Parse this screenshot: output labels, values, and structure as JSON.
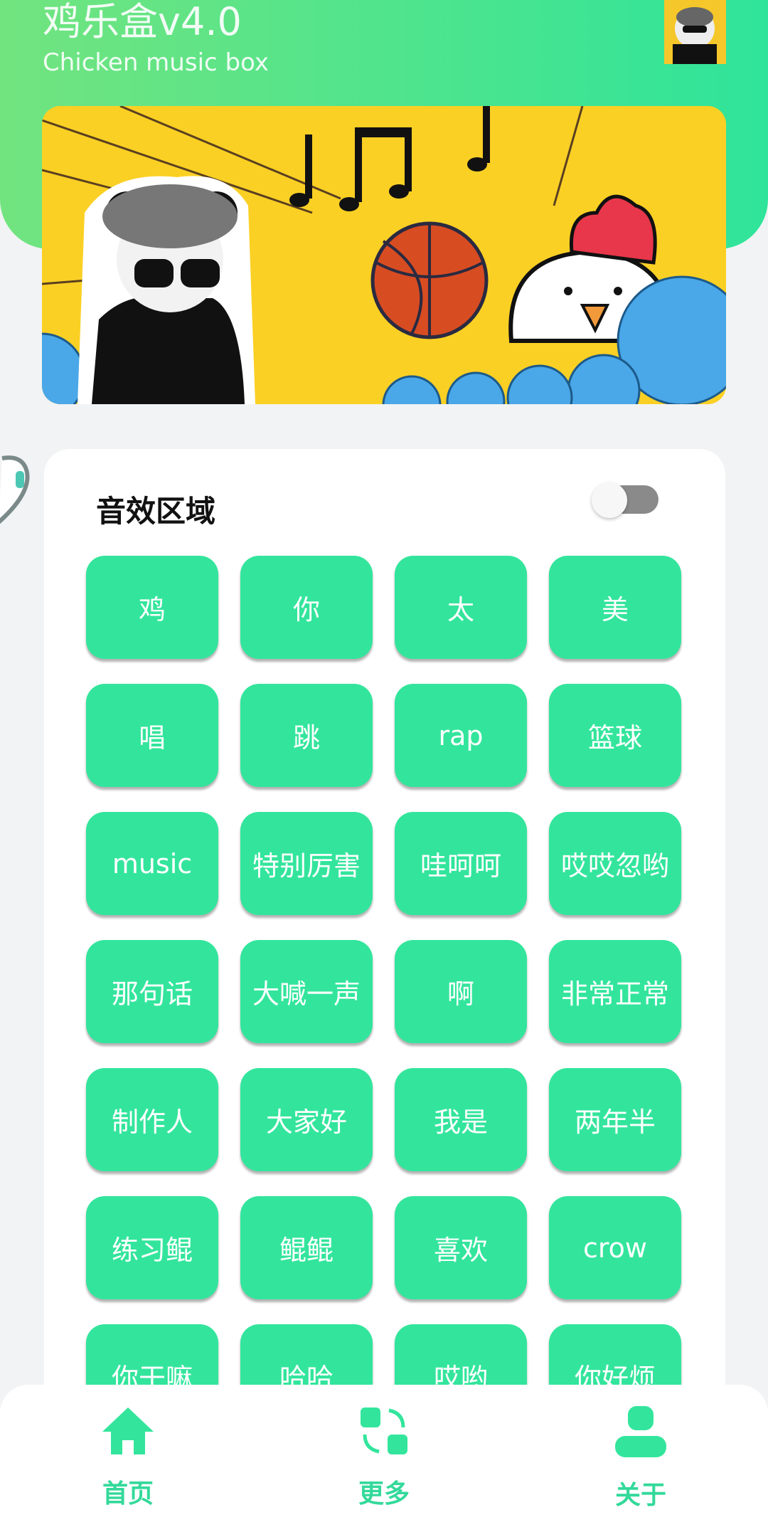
{
  "header": {
    "title": "鸡乐盒v4.0",
    "subtitle": "Chicken music box",
    "avatar_icon": "panda-avatar",
    "accent": "#33e59c"
  },
  "banner": {
    "image": "panda-basketball-chicken-banner"
  },
  "sound_area": {
    "title": "音效区域",
    "toggle_on": false,
    "buttons": [
      "鸡",
      "你",
      "太",
      "美",
      "唱",
      "跳",
      "rap",
      "篮球",
      "music",
      "特别厉害",
      "哇呵呵",
      "哎哎忽哟",
      "那句话",
      "大喊一声",
      "啊",
      "非常正常",
      "制作人",
      "大家好",
      "我是",
      "两年半",
      "练习鲲",
      "鲲鲲",
      "喜欢",
      "crow",
      "你干嘛",
      "哈哈",
      "哎哟",
      "你好烦"
    ]
  },
  "bottom_nav": {
    "items": [
      {
        "label": "首页",
        "icon": "home-icon"
      },
      {
        "label": "更多",
        "icon": "more-icon"
      },
      {
        "label": "关于",
        "icon": "user-icon"
      }
    ]
  }
}
